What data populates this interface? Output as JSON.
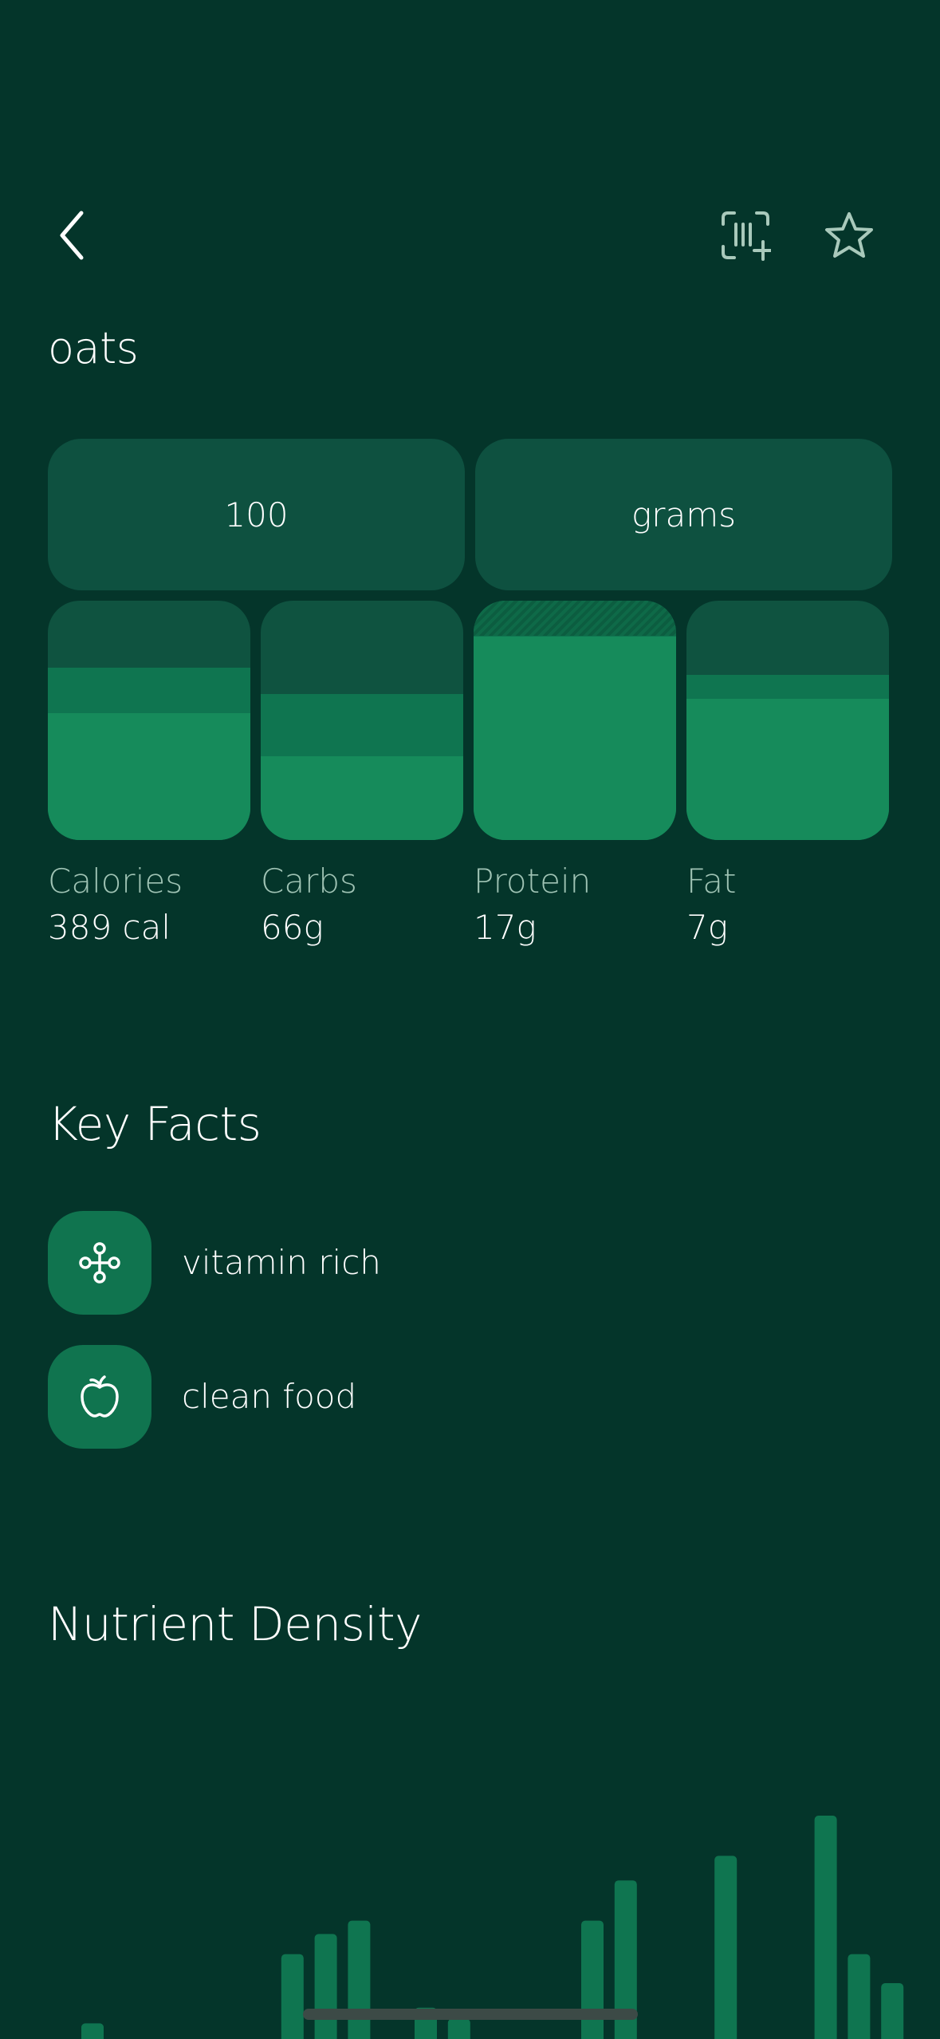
{
  "header": {
    "back_icon": "chevron-left-icon",
    "scan_icon": "barcode-scan-add-icon",
    "favorite_icon": "star-outline-icon"
  },
  "food": {
    "name": "oats"
  },
  "serving": {
    "quantity": "100",
    "unit": "grams"
  },
  "macros": [
    {
      "label": "Calories",
      "value": "389 cal",
      "fill_fraction": 0.53,
      "mid_fraction": 0.72
    },
    {
      "label": "Carbs",
      "value": "66g",
      "fill_fraction": 0.35,
      "mid_fraction": 0.61
    },
    {
      "label": "Protein",
      "value": "17g",
      "fill_fraction": 0.85,
      "mid_fraction": 1.0
    },
    {
      "label": "Fat",
      "value": "7g",
      "fill_fraction": 0.59,
      "mid_fraction": 0.69
    }
  ],
  "key_facts": {
    "title": "Key Facts",
    "items": [
      {
        "label": "vitamin rich",
        "icon": "molecule-icon"
      },
      {
        "label": "clean food",
        "icon": "apple-icon"
      }
    ]
  },
  "nutrient_density": {
    "title": "Nutrient Density"
  },
  "chart_data": {
    "type": "bar",
    "values": [
      0.07,
      0,
      0,
      0,
      0,
      0,
      0.38,
      0.47,
      0.53,
      0,
      0.14,
      0.09,
      0,
      0,
      0,
      0.53,
      0.71,
      0,
      0,
      0.82,
      0,
      0,
      1.0,
      0.38,
      0.25
    ],
    "colors": {
      "bar": "#0f7550"
    }
  }
}
